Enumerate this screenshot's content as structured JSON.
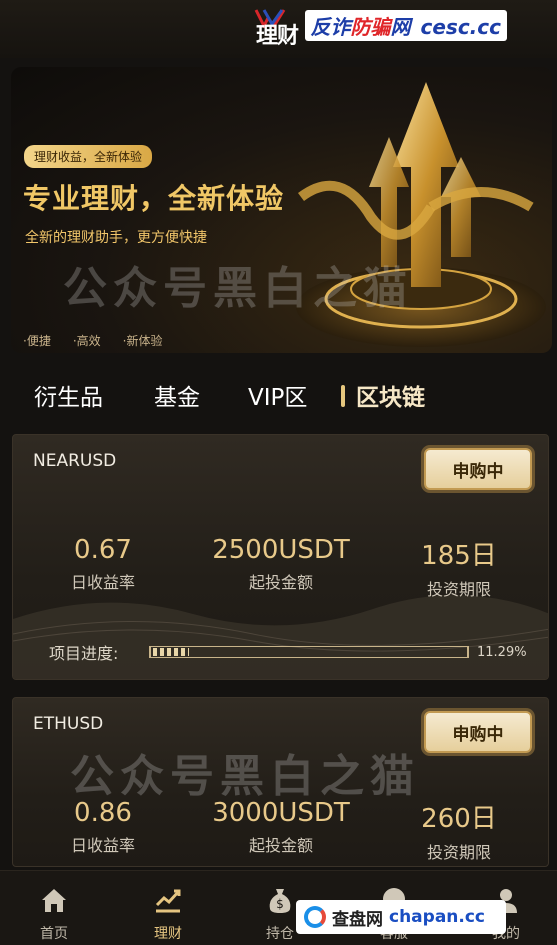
{
  "header": {
    "title": "理财",
    "watermark": {
      "part1": "反诈",
      "part2": "防骗",
      "part3": "网",
      "site": "cesc.cc"
    }
  },
  "banner": {
    "tag": "理财收益，全新体验",
    "title": "专业理财，全新体验",
    "subtitle": "全新的理财助手，更方便快捷",
    "bullets": [
      "·便捷",
      "·高效",
      "·新体验"
    ],
    "stamp": "公众号黑白之猫"
  },
  "tabs": [
    "衍生品",
    "基金",
    "VIP区",
    "区块链"
  ],
  "active_tab": "区块链",
  "products": [
    {
      "name": "NEARUSD",
      "status": "申购中",
      "stats": [
        {
          "value": "0.67",
          "label": "日收益率"
        },
        {
          "value": "2500USDT",
          "label": "起投金额"
        },
        {
          "value": "185日",
          "label": "投资期限"
        }
      ],
      "progress_label": "项目进度:",
      "progress_pct": "11.29%",
      "progress_fraction": 0.1129
    },
    {
      "name": "ETHUSD",
      "status": "申购中",
      "stats": [
        {
          "value": "0.86",
          "label": "日收益率"
        },
        {
          "value": "3000USDT",
          "label": "起投金额"
        },
        {
          "value": "260日",
          "label": "投资期限"
        }
      ]
    }
  ],
  "nav": [
    {
      "label": "首页",
      "icon": "home-icon"
    },
    {
      "label": "理财",
      "icon": "chart-icon",
      "active": true
    },
    {
      "label": "持仓",
      "icon": "money-bag-icon"
    },
    {
      "label": "客服",
      "icon": "service-icon"
    },
    {
      "label": "我的",
      "icon": "profile-icon"
    }
  ],
  "watermark_bottom": {
    "brand": "查盘网",
    "site": "chapan.cc"
  },
  "colors": {
    "accent": "#e8c98a",
    "gold": "#f0c766",
    "bg": "#141210"
  }
}
